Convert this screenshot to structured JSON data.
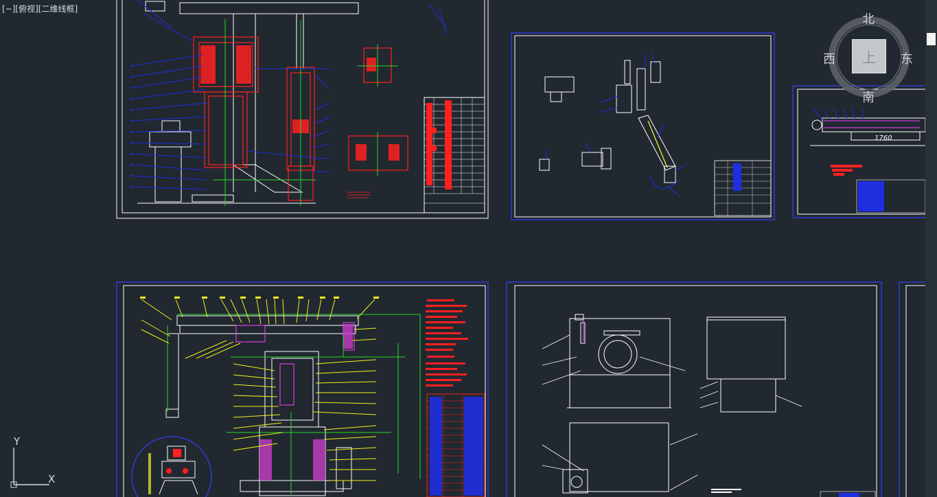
{
  "viewport": {
    "label": "[−][俯视][二维线框]"
  },
  "viewcube": {
    "north": "北",
    "south": "南",
    "east": "东",
    "west": "西",
    "face_top": "上"
  },
  "ucs": {
    "x_label": "X",
    "y_label": "Y"
  },
  "sheets": {
    "sheet2_dimension": "1760"
  },
  "colors": {
    "background": "#212830",
    "frame_white": "#ffffff",
    "border_blue": "#2d3ed6",
    "leader_blue": "#1f2fe0",
    "part_red": "#ff2020",
    "centerline_green": "#22dd22",
    "leader_yellow": "#f2f21a",
    "magenta": "#ff40ff",
    "cyan": "#3ad0ff"
  }
}
